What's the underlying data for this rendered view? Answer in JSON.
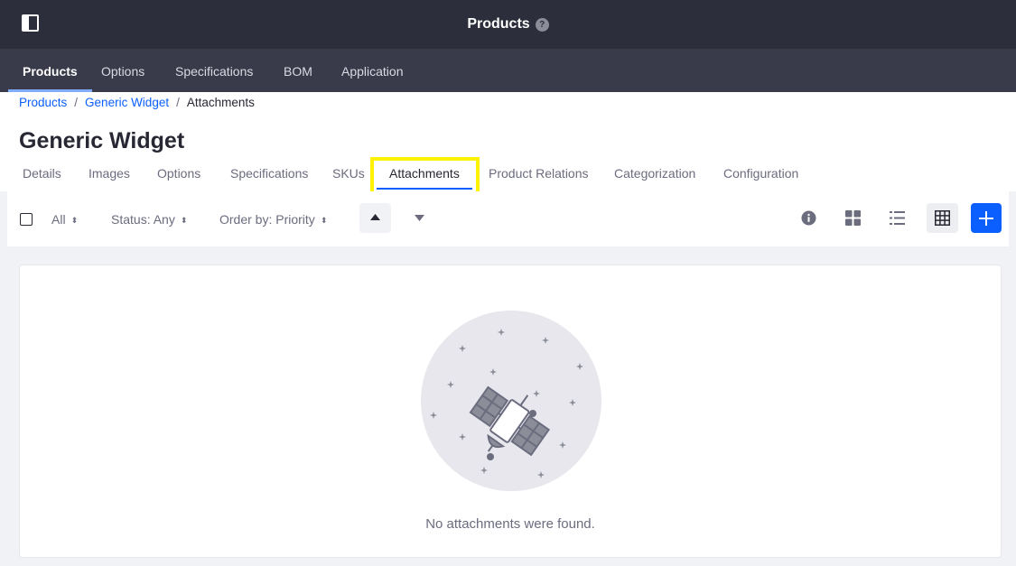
{
  "topbar": {
    "title": "Products",
    "help_glyph": "?",
    "panel_icon": "product-menu-toggle-icon",
    "help_icon": "question-circle-icon"
  },
  "nav": {
    "items": [
      {
        "label": "Products",
        "active": true
      },
      {
        "label": "Options",
        "active": false
      },
      {
        "label": "Specifications",
        "active": false
      },
      {
        "label": "BOM",
        "active": false
      },
      {
        "label": "Application",
        "active": false
      }
    ]
  },
  "breadcrumb": {
    "items": [
      "Products",
      "Generic Widget",
      "Attachments"
    ],
    "separator": "/"
  },
  "page": {
    "title": "Generic Widget"
  },
  "tabs": [
    {
      "label": "Details"
    },
    {
      "label": "Images"
    },
    {
      "label": "Options"
    },
    {
      "label": "Specifications"
    },
    {
      "label": "SKUs"
    },
    {
      "label": "Attachments",
      "active": true
    },
    {
      "label": "Product Relations"
    },
    {
      "label": "Categorization"
    },
    {
      "label": "Configuration"
    }
  ],
  "toolbar": {
    "filter_all": "All",
    "status": "Status: Any",
    "order_by": "Order by: Priority",
    "icons": [
      "info-circle-icon",
      "cards-view-icon",
      "list-view-icon",
      "table-view-icon",
      "plus-icon"
    ]
  },
  "empty_state": {
    "message": "No attachments were found.",
    "illustration": "satellite-illustration"
  },
  "colors": {
    "topbar": "#2c2e3b",
    "navbar": "#393a4a",
    "accent": "#0b5fff",
    "highlight": "#fff200"
  }
}
